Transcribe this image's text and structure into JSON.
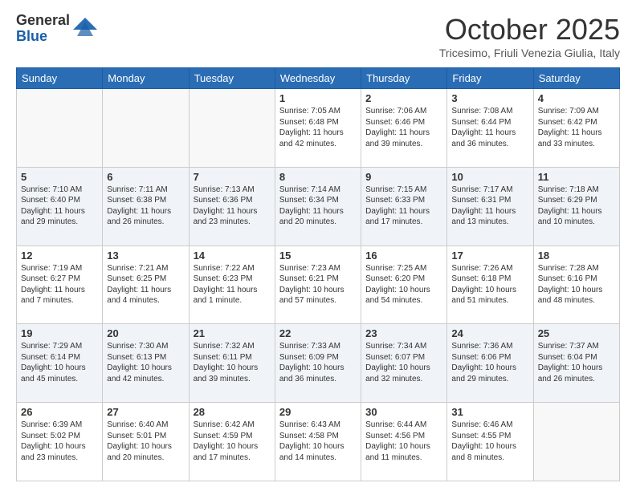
{
  "header": {
    "logo_general": "General",
    "logo_blue": "Blue",
    "title": "October 2025",
    "location": "Tricesimo, Friuli Venezia Giulia, Italy"
  },
  "weekdays": [
    "Sunday",
    "Monday",
    "Tuesday",
    "Wednesday",
    "Thursday",
    "Friday",
    "Saturday"
  ],
  "weeks": [
    [
      {
        "day": "",
        "sunrise": "",
        "sunset": "",
        "daylight": ""
      },
      {
        "day": "",
        "sunrise": "",
        "sunset": "",
        "daylight": ""
      },
      {
        "day": "",
        "sunrise": "",
        "sunset": "",
        "daylight": ""
      },
      {
        "day": "1",
        "sunrise": "Sunrise: 7:05 AM",
        "sunset": "Sunset: 6:48 PM",
        "daylight": "Daylight: 11 hours and 42 minutes."
      },
      {
        "day": "2",
        "sunrise": "Sunrise: 7:06 AM",
        "sunset": "Sunset: 6:46 PM",
        "daylight": "Daylight: 11 hours and 39 minutes."
      },
      {
        "day": "3",
        "sunrise": "Sunrise: 7:08 AM",
        "sunset": "Sunset: 6:44 PM",
        "daylight": "Daylight: 11 hours and 36 minutes."
      },
      {
        "day": "4",
        "sunrise": "Sunrise: 7:09 AM",
        "sunset": "Sunset: 6:42 PM",
        "daylight": "Daylight: 11 hours and 33 minutes."
      }
    ],
    [
      {
        "day": "5",
        "sunrise": "Sunrise: 7:10 AM",
        "sunset": "Sunset: 6:40 PM",
        "daylight": "Daylight: 11 hours and 29 minutes."
      },
      {
        "day": "6",
        "sunrise": "Sunrise: 7:11 AM",
        "sunset": "Sunset: 6:38 PM",
        "daylight": "Daylight: 11 hours and 26 minutes."
      },
      {
        "day": "7",
        "sunrise": "Sunrise: 7:13 AM",
        "sunset": "Sunset: 6:36 PM",
        "daylight": "Daylight: 11 hours and 23 minutes."
      },
      {
        "day": "8",
        "sunrise": "Sunrise: 7:14 AM",
        "sunset": "Sunset: 6:34 PM",
        "daylight": "Daylight: 11 hours and 20 minutes."
      },
      {
        "day": "9",
        "sunrise": "Sunrise: 7:15 AM",
        "sunset": "Sunset: 6:33 PM",
        "daylight": "Daylight: 11 hours and 17 minutes."
      },
      {
        "day": "10",
        "sunrise": "Sunrise: 7:17 AM",
        "sunset": "Sunset: 6:31 PM",
        "daylight": "Daylight: 11 hours and 13 minutes."
      },
      {
        "day": "11",
        "sunrise": "Sunrise: 7:18 AM",
        "sunset": "Sunset: 6:29 PM",
        "daylight": "Daylight: 11 hours and 10 minutes."
      }
    ],
    [
      {
        "day": "12",
        "sunrise": "Sunrise: 7:19 AM",
        "sunset": "Sunset: 6:27 PM",
        "daylight": "Daylight: 11 hours and 7 minutes."
      },
      {
        "day": "13",
        "sunrise": "Sunrise: 7:21 AM",
        "sunset": "Sunset: 6:25 PM",
        "daylight": "Daylight: 11 hours and 4 minutes."
      },
      {
        "day": "14",
        "sunrise": "Sunrise: 7:22 AM",
        "sunset": "Sunset: 6:23 PM",
        "daylight": "Daylight: 11 hours and 1 minute."
      },
      {
        "day": "15",
        "sunrise": "Sunrise: 7:23 AM",
        "sunset": "Sunset: 6:21 PM",
        "daylight": "Daylight: 10 hours and 57 minutes."
      },
      {
        "day": "16",
        "sunrise": "Sunrise: 7:25 AM",
        "sunset": "Sunset: 6:20 PM",
        "daylight": "Daylight: 10 hours and 54 minutes."
      },
      {
        "day": "17",
        "sunrise": "Sunrise: 7:26 AM",
        "sunset": "Sunset: 6:18 PM",
        "daylight": "Daylight: 10 hours and 51 minutes."
      },
      {
        "day": "18",
        "sunrise": "Sunrise: 7:28 AM",
        "sunset": "Sunset: 6:16 PM",
        "daylight": "Daylight: 10 hours and 48 minutes."
      }
    ],
    [
      {
        "day": "19",
        "sunrise": "Sunrise: 7:29 AM",
        "sunset": "Sunset: 6:14 PM",
        "daylight": "Daylight: 10 hours and 45 minutes."
      },
      {
        "day": "20",
        "sunrise": "Sunrise: 7:30 AM",
        "sunset": "Sunset: 6:13 PM",
        "daylight": "Daylight: 10 hours and 42 minutes."
      },
      {
        "day": "21",
        "sunrise": "Sunrise: 7:32 AM",
        "sunset": "Sunset: 6:11 PM",
        "daylight": "Daylight: 10 hours and 39 minutes."
      },
      {
        "day": "22",
        "sunrise": "Sunrise: 7:33 AM",
        "sunset": "Sunset: 6:09 PM",
        "daylight": "Daylight: 10 hours and 36 minutes."
      },
      {
        "day": "23",
        "sunrise": "Sunrise: 7:34 AM",
        "sunset": "Sunset: 6:07 PM",
        "daylight": "Daylight: 10 hours and 32 minutes."
      },
      {
        "day": "24",
        "sunrise": "Sunrise: 7:36 AM",
        "sunset": "Sunset: 6:06 PM",
        "daylight": "Daylight: 10 hours and 29 minutes."
      },
      {
        "day": "25",
        "sunrise": "Sunrise: 7:37 AM",
        "sunset": "Sunset: 6:04 PM",
        "daylight": "Daylight: 10 hours and 26 minutes."
      }
    ],
    [
      {
        "day": "26",
        "sunrise": "Sunrise: 6:39 AM",
        "sunset": "Sunset: 5:02 PM",
        "daylight": "Daylight: 10 hours and 23 minutes."
      },
      {
        "day": "27",
        "sunrise": "Sunrise: 6:40 AM",
        "sunset": "Sunset: 5:01 PM",
        "daylight": "Daylight: 10 hours and 20 minutes."
      },
      {
        "day": "28",
        "sunrise": "Sunrise: 6:42 AM",
        "sunset": "Sunset: 4:59 PM",
        "daylight": "Daylight: 10 hours and 17 minutes."
      },
      {
        "day": "29",
        "sunrise": "Sunrise: 6:43 AM",
        "sunset": "Sunset: 4:58 PM",
        "daylight": "Daylight: 10 hours and 14 minutes."
      },
      {
        "day": "30",
        "sunrise": "Sunrise: 6:44 AM",
        "sunset": "Sunset: 4:56 PM",
        "daylight": "Daylight: 10 hours and 11 minutes."
      },
      {
        "day": "31",
        "sunrise": "Sunrise: 6:46 AM",
        "sunset": "Sunset: 4:55 PM",
        "daylight": "Daylight: 10 hours and 8 minutes."
      },
      {
        "day": "",
        "sunrise": "",
        "sunset": "",
        "daylight": ""
      }
    ]
  ]
}
